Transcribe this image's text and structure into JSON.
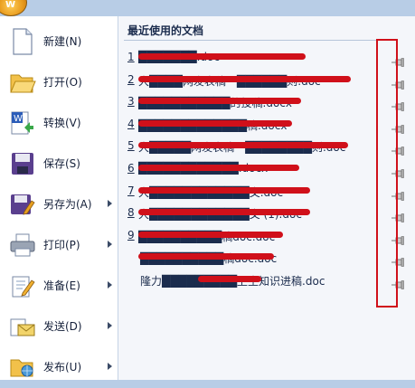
{
  "app": {
    "orb_icon": "office-orb-icon"
  },
  "menu": [
    {
      "id": "new",
      "label": "新建(N)",
      "icon": "new-document-icon",
      "has_submenu": false
    },
    {
      "id": "open",
      "label": "打开(O)",
      "icon": "open-folder-icon",
      "has_submenu": false
    },
    {
      "id": "convert",
      "label": "转换(V)",
      "icon": "convert-icon",
      "has_submenu": false
    },
    {
      "id": "save",
      "label": "保存(S)",
      "icon": "save-icon",
      "has_submenu": false
    },
    {
      "id": "saveas",
      "label": "另存为(A)",
      "icon": "save-as-icon",
      "has_submenu": true
    },
    {
      "id": "print",
      "label": "打印(P)",
      "icon": "printer-icon",
      "has_submenu": true
    },
    {
      "id": "prepare",
      "label": "准备(E)",
      "icon": "prepare-icon",
      "has_submenu": true
    },
    {
      "id": "send",
      "label": "发送(D)",
      "icon": "send-icon",
      "has_submenu": true
    },
    {
      "id": "publish",
      "label": "发布(U)",
      "icon": "publish-icon",
      "has_submenu": true
    }
  ],
  "recent": {
    "title": "最近使用的文档",
    "documents": [
      {
        "num": "1",
        "name": "███████.doc",
        "redacted": true,
        "pin_icon": "pushpin-icon"
      },
      {
        "num": "2",
        "name": "大████网发表稿一██████则.doc",
        "redacted": true,
        "pin_icon": "pushpin-icon"
      },
      {
        "num": "3",
        "name": "███████████的投稿.docx",
        "redacted": true,
        "pin_icon": "pushpin-icon"
      },
      {
        "num": "4",
        "name": "█████████████稿.docx",
        "redacted": true,
        "pin_icon": "pushpin-icon"
      },
      {
        "num": "5",
        "name": "大█████网发表稿一████████则.doc",
        "redacted": true,
        "pin_icon": "pushpin-icon"
      },
      {
        "num": "6",
        "name": "████████████.docx",
        "redacted": true,
        "pin_icon": "pushpin-icon"
      },
      {
        "num": "7",
        "name": "大████████████文.doc",
        "redacted": true,
        "pin_icon": "pushpin-icon"
      },
      {
        "num": "8",
        "name": "大████████████文 (1).doc",
        "redacted": true,
        "pin_icon": "pushpin-icon"
      },
      {
        "num": "9",
        "name": "██████████稿doc.doc",
        "redacted": true,
        "pin_icon": "pushpin-icon"
      },
      {
        "num": "",
        "name": "██████████稿doc.doc",
        "redacted": true,
        "pin_icon": "pushpin-icon"
      },
      {
        "num": "",
        "name": "隆力█████████卫生知识进稿.doc",
        "redacted": false,
        "pin_icon": "pushpin-icon"
      }
    ]
  },
  "annotation": {
    "color": "#d0101a"
  }
}
